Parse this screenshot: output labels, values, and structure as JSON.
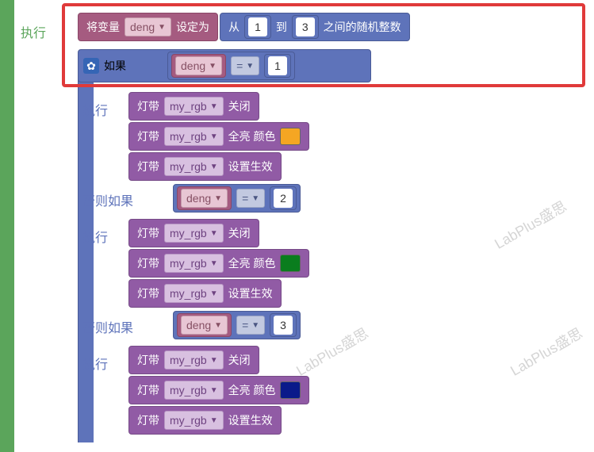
{
  "labels": {
    "exec": "执行",
    "set_var": "将变量",
    "set_to": "设定为",
    "from": "从",
    "to": "到",
    "random_int": "之间的随机整数",
    "if": "如果",
    "else_if": "否则如果",
    "led_strip": "灯带",
    "off": "关闭",
    "full_bright": "全亮 颜色",
    "apply": "设置生效",
    "equals": "="
  },
  "vars": {
    "deng": "deng",
    "my_rgb": "my_rgb"
  },
  "nums": {
    "one": "1",
    "two": "2",
    "three": "3"
  },
  "colors": {
    "orange": "#f5a623",
    "green": "#0a7d1e",
    "navy": "#0a1a8a"
  },
  "watermark": "LabPlus盛思"
}
